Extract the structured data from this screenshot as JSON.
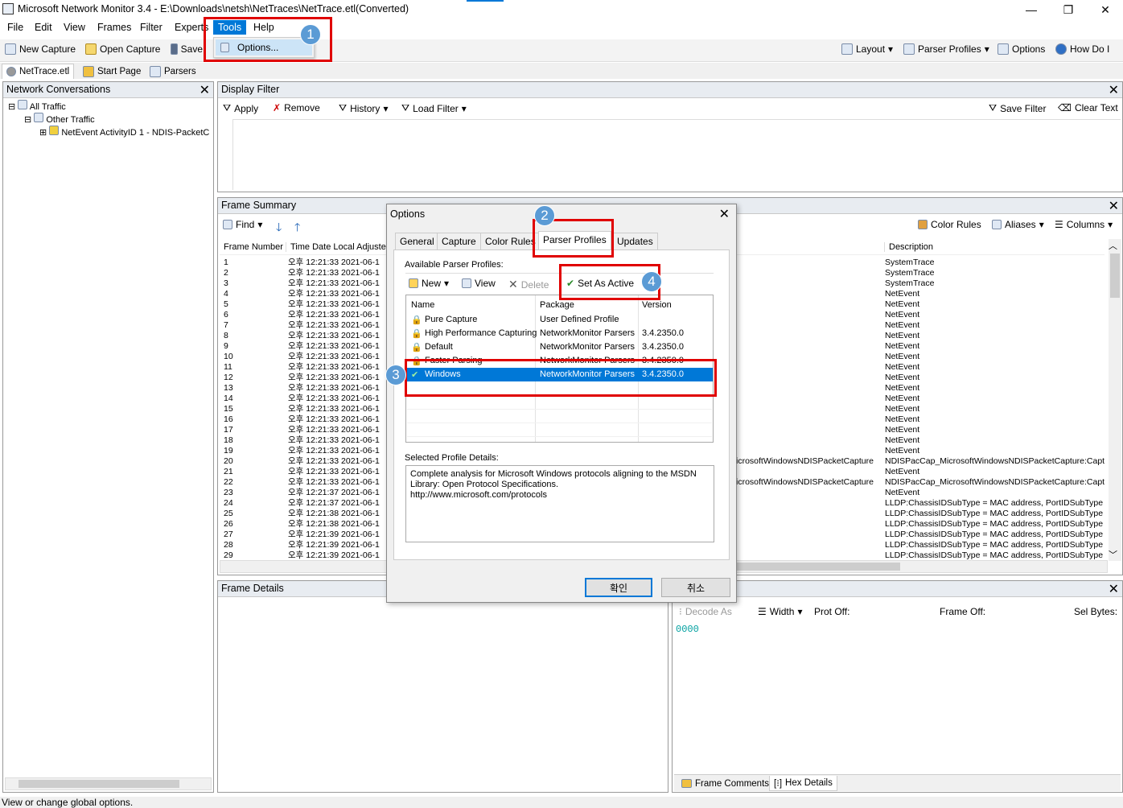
{
  "window": {
    "title": "Microsoft Network Monitor 3.4 - E:\\Downloads\\netsh\\NetTraces\\NetTrace.etl(Converted)",
    "minimize": "—",
    "restore": "❐",
    "close": "✕"
  },
  "menu": {
    "items": [
      "File",
      "Edit",
      "View",
      "Frames",
      "Filter",
      "Experts",
      "Tools",
      "Help"
    ],
    "dropdown_option": "Options..."
  },
  "toolbar": {
    "new_capture": "New Capture",
    "open_capture": "Open Capture",
    "save": "Save",
    "layout": "Layout",
    "parser_profiles": "Parser Profiles",
    "options": "Options",
    "how_do_i": "How Do I"
  },
  "doc_tabs": [
    "NetTrace.etl",
    "Start Page",
    "Parsers"
  ],
  "network_conversations": {
    "title": "Network Conversations",
    "tree": [
      "All Traffic",
      "Other Traffic",
      "NetEvent ActivityID 1 - NDIS-PacketC"
    ]
  },
  "display_filter": {
    "title": "Display Filter",
    "apply": "Apply",
    "remove": "Remove",
    "history": "History",
    "load_filter": "Load Filter",
    "save_filter": "Save Filter",
    "clear_text": "Clear Text"
  },
  "frame_summary": {
    "title": "Frame Summary",
    "find": "Find",
    "color_rules": "Color Rules",
    "aliases": "Aliases",
    "columns": "Columns",
    "col_frame_number": "Frame Number",
    "col_time": "Time Date Local Adjusted",
    "col_description": "Description",
    "rows": [
      {
        "n": "1",
        "t": "오후 12:21:33 2021-06-1",
        "mid": "",
        "d": "SystemTrace"
      },
      {
        "n": "2",
        "t": "오후 12:21:33 2021-06-1",
        "mid": "",
        "d": "SystemTrace"
      },
      {
        "n": "3",
        "t": "오후 12:21:33 2021-06-1",
        "mid": "",
        "d": "SystemTrace"
      },
      {
        "n": "4",
        "t": "오후 12:21:33 2021-06-1",
        "mid": "",
        "d": "NetEvent"
      },
      {
        "n": "5",
        "t": "오후 12:21:33 2021-06-1",
        "mid": "",
        "d": "NetEvent"
      },
      {
        "n": "6",
        "t": "오후 12:21:33 2021-06-1",
        "mid": "",
        "d": "NetEvent"
      },
      {
        "n": "7",
        "t": "오후 12:21:33 2021-06-1",
        "mid": "",
        "d": "NetEvent"
      },
      {
        "n": "8",
        "t": "오후 12:21:33 2021-06-1",
        "mid": "",
        "d": "NetEvent"
      },
      {
        "n": "9",
        "t": "오후 12:21:33 2021-06-1",
        "mid": "",
        "d": "NetEvent"
      },
      {
        "n": "10",
        "t": "오후 12:21:33 2021-06-1",
        "mid": "",
        "d": "NetEvent"
      },
      {
        "n": "11",
        "t": "오후 12:21:33 2021-06-1",
        "mid": "",
        "d": "NetEvent"
      },
      {
        "n": "12",
        "t": "오후 12:21:33 2021-06-1",
        "mid": "",
        "d": "NetEvent"
      },
      {
        "n": "13",
        "t": "오후 12:21:33 2021-06-1",
        "mid": "",
        "d": "NetEvent"
      },
      {
        "n": "14",
        "t": "오후 12:21:33 2021-06-1",
        "mid": "",
        "d": "NetEvent"
      },
      {
        "n": "15",
        "t": "오후 12:21:33 2021-06-1",
        "mid": "",
        "d": "NetEvent"
      },
      {
        "n": "16",
        "t": "오후 12:21:33 2021-06-1",
        "mid": "",
        "d": "NetEvent"
      },
      {
        "n": "17",
        "t": "오후 12:21:33 2021-06-1",
        "mid": "",
        "d": "NetEvent"
      },
      {
        "n": "18",
        "t": "오후 12:21:33 2021-06-1",
        "mid": "",
        "d": "NetEvent"
      },
      {
        "n": "19",
        "t": "오후 12:21:33 2021-06-1",
        "mid": "",
        "d": "NetEvent"
      },
      {
        "n": "20",
        "t": "오후 12:21:33 2021-06-1",
        "mid": "icrosoftWindowsNDISPacketCapture",
        "d": "NDISPacCap_MicrosoftWindowsNDISPacketCapture:Capt"
      },
      {
        "n": "21",
        "t": "오후 12:21:33 2021-06-1",
        "mid": "",
        "d": "NetEvent"
      },
      {
        "n": "22",
        "t": "오후 12:21:33 2021-06-1",
        "mid": "icrosoftWindowsNDISPacketCapture",
        "d": "NDISPacCap_MicrosoftWindowsNDISPacketCapture:Capt"
      },
      {
        "n": "23",
        "t": "오후 12:21:37 2021-06-1",
        "mid": "",
        "d": "NetEvent"
      },
      {
        "n": "24",
        "t": "오후 12:21:37 2021-06-1",
        "mid": "",
        "d": "LLDP:ChassisIDSubType = MAC address, PortIDSubType"
      },
      {
        "n": "25",
        "t": "오후 12:21:38 2021-06-1",
        "mid": "",
        "d": "LLDP:ChassisIDSubType = MAC address, PortIDSubType"
      },
      {
        "n": "26",
        "t": "오후 12:21:38 2021-06-1",
        "mid": "",
        "d": "LLDP:ChassisIDSubType = MAC address, PortIDSubType"
      },
      {
        "n": "27",
        "t": "오후 12:21:39 2021-06-1",
        "mid": "",
        "d": "LLDP:ChassisIDSubType = MAC address, PortIDSubType"
      },
      {
        "n": "28",
        "t": "오후 12:21:39 2021-06-1",
        "mid": "",
        "d": "LLDP:ChassisIDSubType = MAC address, PortIDSubType"
      },
      {
        "n": "29",
        "t": "오후 12:21:39 2021-06-1",
        "mid": "",
        "d": "LLDP:ChassisIDSubType = MAC address, PortIDSubType"
      }
    ]
  },
  "frame_details": {
    "title": "Frame Details"
  },
  "hex_pane": {
    "decode_as": "Decode As",
    "width": "Width",
    "prot_off": "Prot Off:",
    "frame_off": "Frame Off:",
    "sel_bytes": "Sel Bytes:",
    "offset": "0000",
    "tab_comments": "Frame Comments",
    "tab_hex": "Hex Details"
  },
  "options_dialog": {
    "title": "Options",
    "tabs": [
      "General",
      "Capture",
      "Color Rules",
      "Parser Profiles",
      "Updates"
    ],
    "available_label": "Available Parser Profiles:",
    "new": "New",
    "view": "View",
    "delete": "Delete",
    "set_as_active": "Set As Active",
    "col_name": "Name",
    "col_package": "Package",
    "col_version": "Version",
    "profiles": [
      {
        "name": "Pure Capture",
        "package": "User Defined Profile",
        "version": ""
      },
      {
        "name": "High Performance Capturing",
        "package": "NetworkMonitor Parsers",
        "version": "3.4.2350.0"
      },
      {
        "name": "Default",
        "package": "NetworkMonitor Parsers",
        "version": "3.4.2350.0"
      },
      {
        "name": "Faster Parsing",
        "package": "NetworkMonitor Parsers",
        "version": "3.4.2350.0"
      },
      {
        "name": "Windows",
        "package": "NetworkMonitor Parsers",
        "version": "3.4.2350.0"
      }
    ],
    "details_label": "Selected Profile Details:",
    "details_text": "Complete analysis for Microsoft Windows protocols aligning to the MSDN Library: Open Protocol Specifications.\nhttp://www.microsoft.com/protocols",
    "ok": "확인",
    "cancel": "취소"
  },
  "annotations": [
    "1",
    "2",
    "3",
    "4"
  ],
  "status": "View or change global options.",
  "colors": {
    "accent": "#0078d7",
    "highlight_box": "#e00000",
    "badge": "#5b9bd5",
    "hex_offset": "#00a0a0"
  }
}
